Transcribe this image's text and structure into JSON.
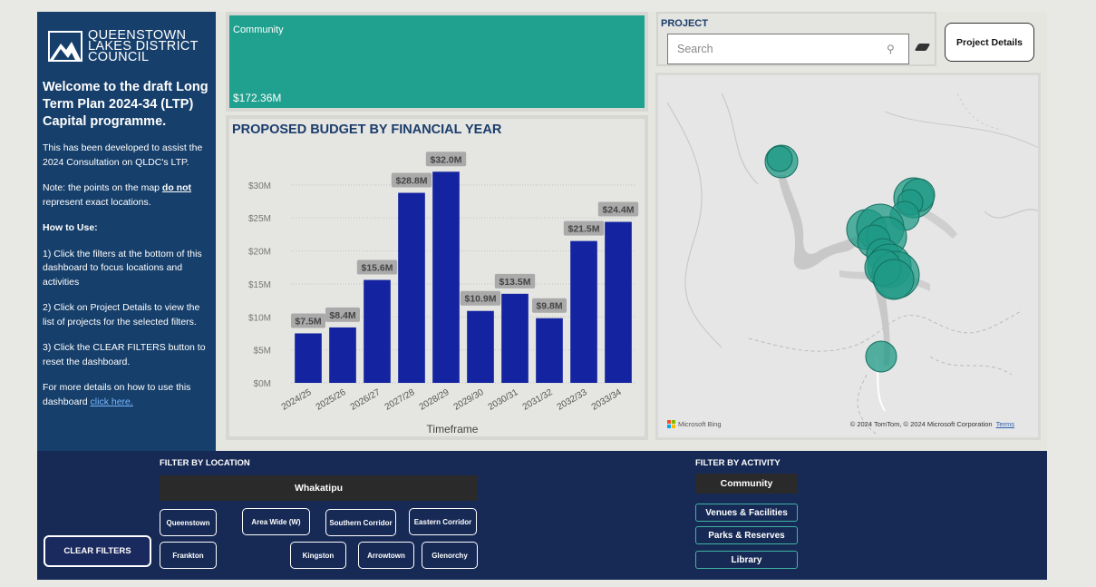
{
  "sidebar": {
    "logo_lines": [
      "QUEENSTOWN",
      "LAKES DISTRICT",
      "COUNCIL"
    ],
    "welcome": "Welcome to the draft Long Term Plan 2024-34 (LTP) Capital programme.",
    "intro": "This has been developed to assist the 2024 Consultation on QLDC's LTP.",
    "note_prefix": "Note: the points on the map ",
    "note_emph": "do not",
    "note_suffix": " represent exact locations.",
    "how_to_use": "How to Use:",
    "step1": "1) Click the filters at the bottom of this dashboard to focus locations and activities",
    "step2": "2) Click on Project Details to view the list of projects for the selected filters.",
    "step3": "3) Click the CLEAR FILTERS button to reset the dashboard.",
    "more_prefix": "For more details on how to use this dashboard ",
    "more_link": "click here."
  },
  "community_card": {
    "label": "Community",
    "value": "$172.36M",
    "color": "#20a08e"
  },
  "chart_data": {
    "type": "bar",
    "title": "PROPOSED BUDGET BY FINANCIAL YEAR",
    "xlabel": "Timeframe",
    "ylabel": "",
    "categories": [
      "2024/25",
      "2025/26",
      "2026/27",
      "2027/28",
      "2028/29",
      "2029/30",
      "2030/31",
      "2031/32",
      "2032/33",
      "2033/34"
    ],
    "values": [
      7.5,
      8.4,
      15.6,
      28.8,
      32.0,
      10.9,
      13.5,
      9.8,
      21.5,
      24.4
    ],
    "data_labels": [
      "$7.5M",
      "$8.4M",
      "$15.6M",
      "$28.8M",
      "$32.0M",
      "$10.9M",
      "$13.5M",
      "$9.8M",
      "$21.5M",
      "$24.4M"
    ],
    "y_ticks": [
      0,
      5,
      10,
      15,
      20,
      25,
      30
    ],
    "y_tick_labels": [
      "$0M",
      "$5M",
      "$10M",
      "$15M",
      "$20M",
      "$25M",
      "$30M"
    ],
    "ylim": [
      0,
      33
    ],
    "bar_color": "#1424a0",
    "grid": true
  },
  "project": {
    "label": "PROJECT",
    "search_placeholder": "Search",
    "details_button": "Project Details"
  },
  "map": {
    "bing_label": "Microsoft Bing",
    "attribution": "© 2024 TomTom, © 2024 Microsoft Corporation",
    "terms": "Terms",
    "marker_color": "#1f9a86"
  },
  "filters": {
    "location_title": "FILTER BY LOCATION",
    "region": "Whakatipu",
    "locations_row1": [
      "Queenstown",
      "Area Wide (W)",
      "Southern Corridor",
      "Eastern Corridor"
    ],
    "locations_row2": [
      "Frankton",
      "Kingston",
      "Arrowtown",
      "Glenorchy"
    ],
    "clear_button": "CLEAR FILTERS",
    "activity_title": "FILTER BY ACTIVITY",
    "activity_selected": "Community",
    "activities": [
      "Venues & Facilities",
      "Parks & Reserves",
      "Library"
    ]
  }
}
